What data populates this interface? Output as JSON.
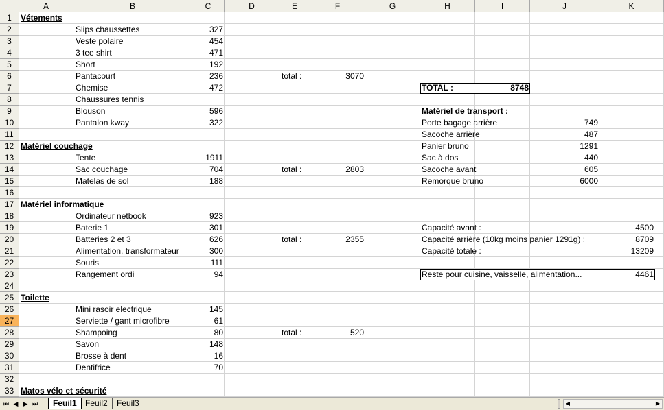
{
  "columns": [
    "A",
    "B",
    "C",
    "D",
    "E",
    "F",
    "G",
    "H",
    "I",
    "J",
    "K"
  ],
  "rows": [
    "1",
    "2",
    "3",
    "4",
    "5",
    "6",
    "7",
    "8",
    "9",
    "10",
    "11",
    "12",
    "13",
    "14",
    "15",
    "16",
    "17",
    "18",
    "19",
    "20",
    "21",
    "22",
    "23",
    "24",
    "25",
    "26",
    "27",
    "28",
    "29",
    "30",
    "31",
    "32",
    "33"
  ],
  "active_row": "27",
  "sections": {
    "vetements": "Vétements",
    "couchage": "Matériel couchage",
    "informatique": "Matériel informatique",
    "toilette": "Toilette",
    "velo": "Matos vélo et sécurité"
  },
  "vetements_items": [
    {
      "name": "Slips chaussettes",
      "value": "327"
    },
    {
      "name": "Veste polaire",
      "value": "454"
    },
    {
      "name": "3 tee shirt",
      "value": "471"
    },
    {
      "name": "Short",
      "value": "192"
    },
    {
      "name": "Pantacourt",
      "value": "236"
    },
    {
      "name": "Chemise",
      "value": "472"
    },
    {
      "name": "Chaussures tennis",
      "value": ""
    },
    {
      "name": "Blouson",
      "value": "596"
    },
    {
      "name": "Pantalon kway",
      "value": "322"
    }
  ],
  "couchage_items": [
    {
      "name": "Tente",
      "value": "1911"
    },
    {
      "name": "Sac couchage",
      "value": "704"
    },
    {
      "name": "Matelas de sol",
      "value": "188"
    }
  ],
  "informatique_items": [
    {
      "name": "Ordinateur netbook",
      "value": "923"
    },
    {
      "name": "Baterie 1",
      "value": "301"
    },
    {
      "name": "Batteries 2 et 3",
      "value": "626"
    },
    {
      "name": "Alimentation, transformateur",
      "value": "300"
    },
    {
      "name": "Souris",
      "value": "111"
    },
    {
      "name": "Rangement ordi",
      "value": "94"
    }
  ],
  "toilette_items": [
    {
      "name": "Mini rasoir electrique",
      "value": "145"
    },
    {
      "name": "Serviette / gant microfibre",
      "value": "61"
    },
    {
      "name": "Shampoing",
      "value": "80"
    },
    {
      "name": "Savon",
      "value": "148"
    },
    {
      "name": "Brosse à dent",
      "value": "16"
    },
    {
      "name": "Dentifrice",
      "value": "70"
    }
  ],
  "totals": {
    "label": "total :",
    "vetements": "3070",
    "couchage": "2803",
    "informatique": "2355",
    "toilette": "520"
  },
  "grand_total": {
    "label": "TOTAL :",
    "value": "8748"
  },
  "transport": {
    "title": "Matériel de transport :",
    "items": [
      {
        "name": "Porte bagage arrière",
        "value": "749"
      },
      {
        "name": "Sacoche arrière",
        "value": "487"
      },
      {
        "name": "Panier bruno",
        "value": "1291"
      },
      {
        "name": "Sac à dos",
        "value": "440"
      },
      {
        "name": "Sacoche avant",
        "value": "605"
      },
      {
        "name": "Remorque bruno",
        "value": "6000"
      }
    ]
  },
  "capacity": [
    {
      "name": "Capacité avant :",
      "value": "4500"
    },
    {
      "name": "Capacité arrière (10kg moins panier 1291g) :",
      "value": "8709"
    },
    {
      "name": "Capacité totale :",
      "value": "13209"
    }
  ],
  "reste": {
    "label": "Reste pour cuisine, vaisselle, alimentation...",
    "value": "4461"
  },
  "sheet_tabs": [
    "Feuil1",
    "Feuil2",
    "Feuil3"
  ],
  "active_tab": "Feuil1",
  "nav_icons": [
    "first-sheet-icon",
    "prev-sheet-icon",
    "next-sheet-icon",
    "last-sheet-icon"
  ]
}
